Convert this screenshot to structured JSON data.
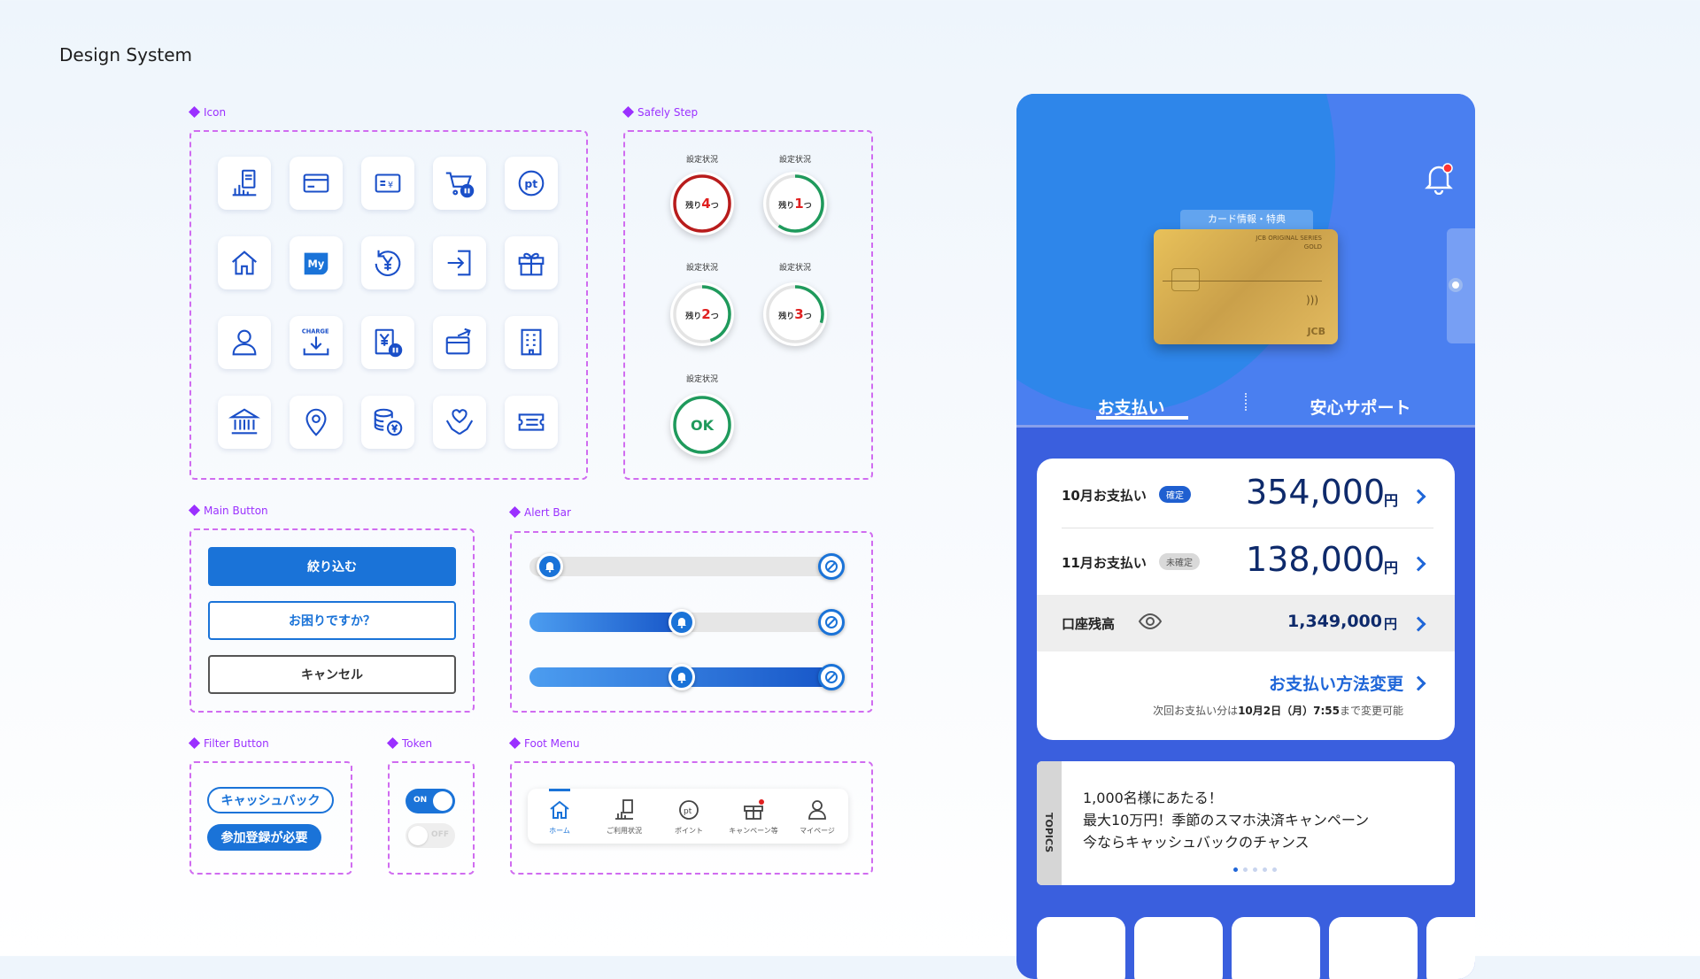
{
  "page_title": "Design System",
  "sections": {
    "icon": "Icon",
    "safely_step": "Safely Step",
    "main_button": "Main Button",
    "alert_bar": "Alert Bar",
    "filter_button": "Filter Button",
    "token": "Token",
    "foot_menu": "Foot Menu"
  },
  "icons": {
    "pt_label": "pt",
    "my_label": "My",
    "charge_label": "CHARGE",
    "yen": "¥"
  },
  "safely_step": {
    "caption": "設定状況",
    "remain_prefix": "残り",
    "remain_suffix": "つ",
    "steps": [
      "4",
      "1",
      "2",
      "3"
    ],
    "ok": "OK",
    "progress": [
      0.0,
      0.6,
      0.45,
      0.3
    ]
  },
  "main_buttons": {
    "primary": "絞り込む",
    "secondary": "お困りですか？",
    "tertiary": "キャンセル"
  },
  "alert_bar": {
    "levels": [
      0.0,
      0.5,
      1.0
    ]
  },
  "filter_buttons": {
    "outline": "キャッシュバック",
    "filled": "参加登録が必要"
  },
  "token": {
    "on": "ON",
    "off": "OFF"
  },
  "foot_menu": {
    "items": [
      "ホーム",
      "ご利用状況",
      "ポイント",
      "キャンペーン等",
      "マイページ"
    ]
  },
  "phone": {
    "card_header": "カード情報・特典",
    "card_series": "JCB ORIGINAL SERIES",
    "card_grade": "GOLD",
    "card_brand": "JCB",
    "tabs": [
      "お支払い",
      "安心サポート"
    ],
    "payments": [
      {
        "label": "10月お支払い",
        "status": "確定",
        "amount": "354,000",
        "unit": "円"
      },
      {
        "label": "11月お支払い",
        "status": "未確定",
        "amount": "138,000",
        "unit": "円"
      }
    ],
    "balance": {
      "label": "口座残高",
      "amount": "1,349,000",
      "unit": "円"
    },
    "change_method": "お支払い方法変更",
    "change_note_pre": "次回お支払い分は",
    "change_note_date": "10月2日（月）7:55",
    "change_note_post": "まで変更可能",
    "topics_tag": "TOPICS",
    "topics_lines": [
      "1,000名様にあたる！",
      "最大10万円！季節のスマホ決済キャンペーン",
      "今ならキャッシュバックのチャンス"
    ]
  },
  "colors": {
    "primary": "#1a73d8",
    "purple": "#9b30ff",
    "red": "#e02020",
    "green": "#1f9a5c",
    "phone_blue": "#3a5fde"
  }
}
